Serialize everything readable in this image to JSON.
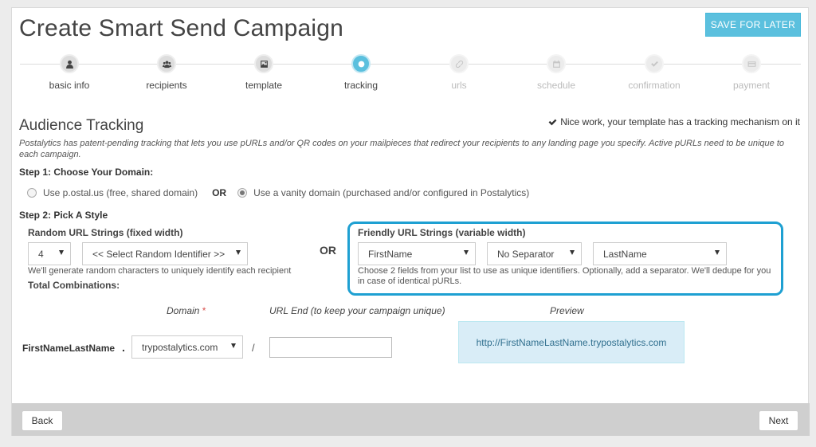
{
  "header": {
    "title": "Create Smart Send Campaign",
    "save_label": "SAVE FOR LATER"
  },
  "steps": [
    {
      "label": "basic info",
      "icon": "user-icon",
      "state": "done"
    },
    {
      "label": "recipients",
      "icon": "users-icon",
      "state": "done"
    },
    {
      "label": "template",
      "icon": "image-icon",
      "state": "done"
    },
    {
      "label": "tracking",
      "icon": "circle-icon",
      "state": "active"
    },
    {
      "label": "urls",
      "icon": "link-icon",
      "state": "todo"
    },
    {
      "label": "schedule",
      "icon": "calendar-icon",
      "state": "todo"
    },
    {
      "label": "confirmation",
      "icon": "check-icon",
      "state": "todo"
    },
    {
      "label": "payment",
      "icon": "credit-card-icon",
      "state": "todo"
    }
  ],
  "tracking": {
    "heading": "Audience Tracking",
    "notice": "Nice work, your template has a tracking mechanism on it",
    "intro": "Postalytics has patent-pending tracking that lets you use pURLs and/or QR codes on your mailpieces that redirect your recipients to any landing page you specify. Active pURLs need to be unique to each campaign."
  },
  "step1": {
    "heading": "Step 1: Choose Your Domain:",
    "option_shared": "Use p.ostal.us (free, shared domain)",
    "or": "OR",
    "option_vanity": "Use a vanity domain (purchased and/or configured in Postalytics)",
    "selected": "vanity"
  },
  "step2": {
    "heading": "Step 2: Pick A Style",
    "random_label": "Random URL Strings (fixed width)",
    "random_length": "4",
    "random_identifier": "<< Select Random Identifier >>",
    "random_help": "We'll generate random characters to uniquely identify each recipient",
    "total_label": "Total Combinations:",
    "or": "OR",
    "friendly_label": "Friendly URL Strings (variable width)",
    "field1": "FirstName",
    "separator": "No Separator",
    "field2": "LastName",
    "friendly_help": "Choose 2 fields from your list to use as unique identifiers. Optionally, add a separator. We'll dedupe for you in case of identical pURLs."
  },
  "domain_row": {
    "domain_header": "Domain",
    "required_mark": "*",
    "url_end_header": "URL End (to keep your campaign unique)",
    "preview_header": "Preview",
    "purl_string": "FirstNameLastName",
    "dot": ".",
    "domain_value": "trypostalytics.com",
    "slash": "/",
    "url_end_value": "",
    "preview_url": "http://FirstNameLastName.trypostalytics.com"
  },
  "footer": {
    "back_label": "Back",
    "next_label": "Next"
  },
  "colors": {
    "accent": "#5bc0de",
    "highlight_border": "#1ea0d2",
    "preview_bg": "#d9edf7",
    "required": "#d9534f"
  }
}
